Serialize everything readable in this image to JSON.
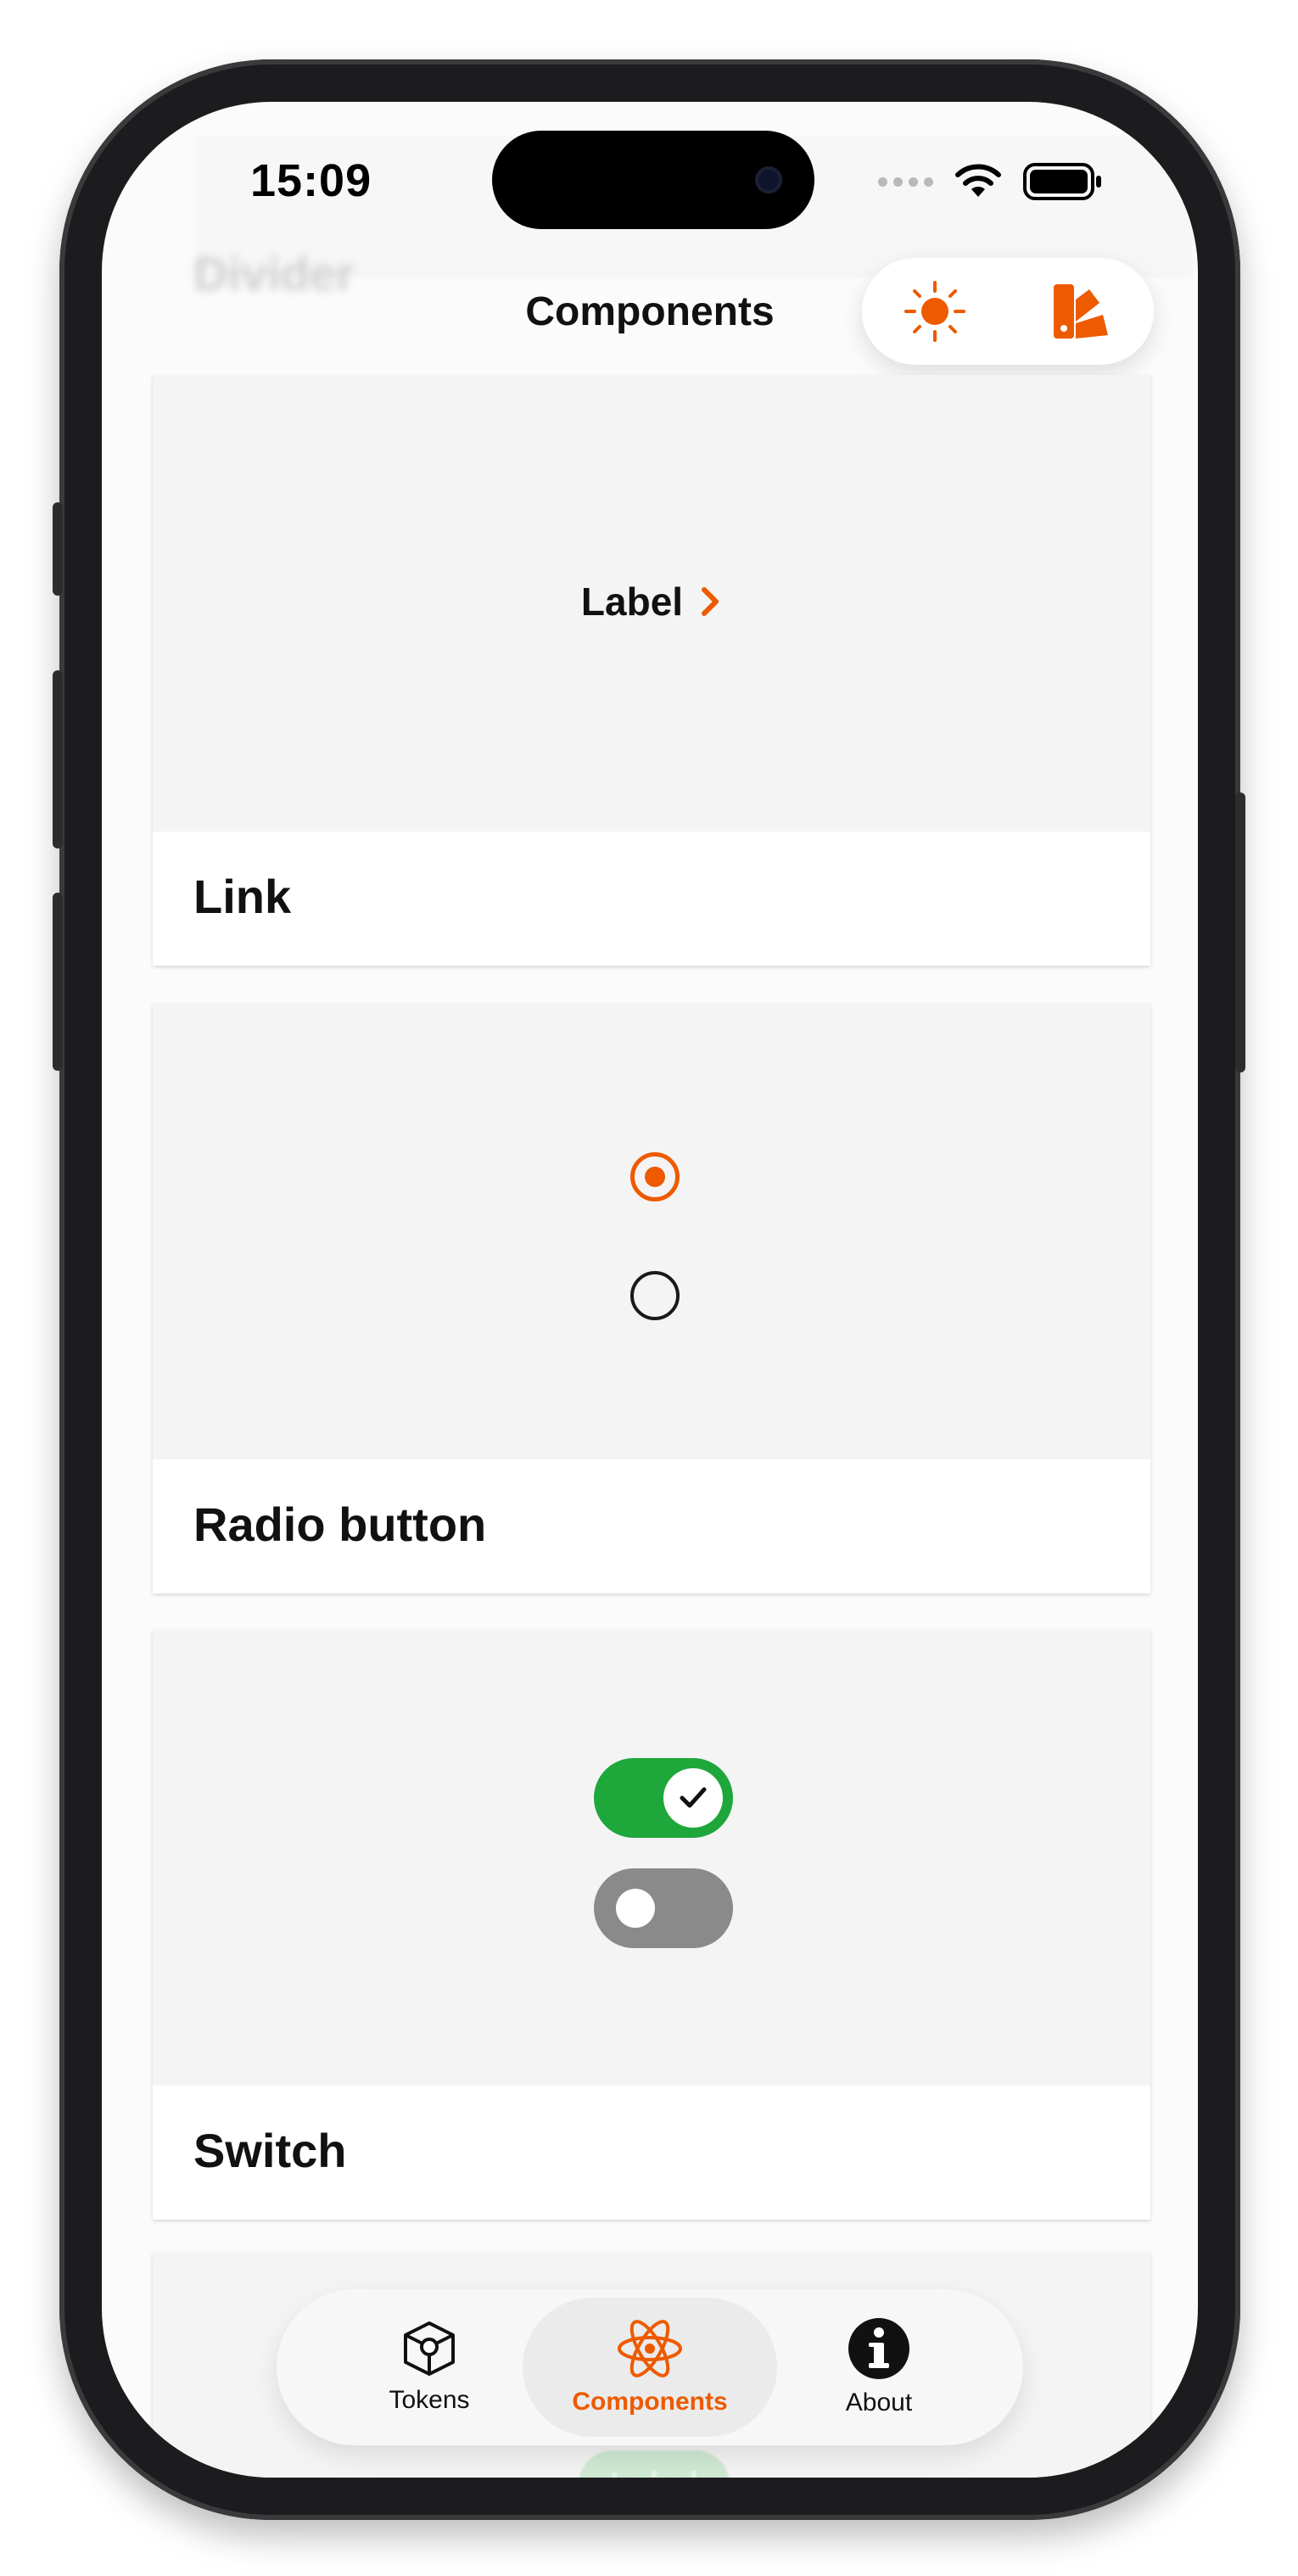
{
  "status_bar": {
    "time": "15:09"
  },
  "header": {
    "blurred_section_title": "Divider",
    "title": "Components"
  },
  "cards": [
    {
      "title": "Link",
      "preview_label": "Label"
    },
    {
      "title": "Radio button",
      "options": [
        {
          "checked": true
        },
        {
          "checked": false
        }
      ]
    },
    {
      "title": "Switch",
      "switches": [
        {
          "on": true
        },
        {
          "on": false
        }
      ]
    }
  ],
  "partial_preview": {
    "chip_label": "Label"
  },
  "tab_bar": {
    "tabs": [
      {
        "label": "Tokens",
        "icon": "cube-icon",
        "active": false
      },
      {
        "label": "Components",
        "icon": "atom-icon",
        "active": true
      },
      {
        "label": "About",
        "icon": "info-icon",
        "active": false
      }
    ]
  },
  "colors": {
    "accent": "#ee5a00",
    "switch_on": "#1ea73a",
    "switch_off": "#8a8a8a",
    "preview_bg": "#f4f4f4"
  }
}
